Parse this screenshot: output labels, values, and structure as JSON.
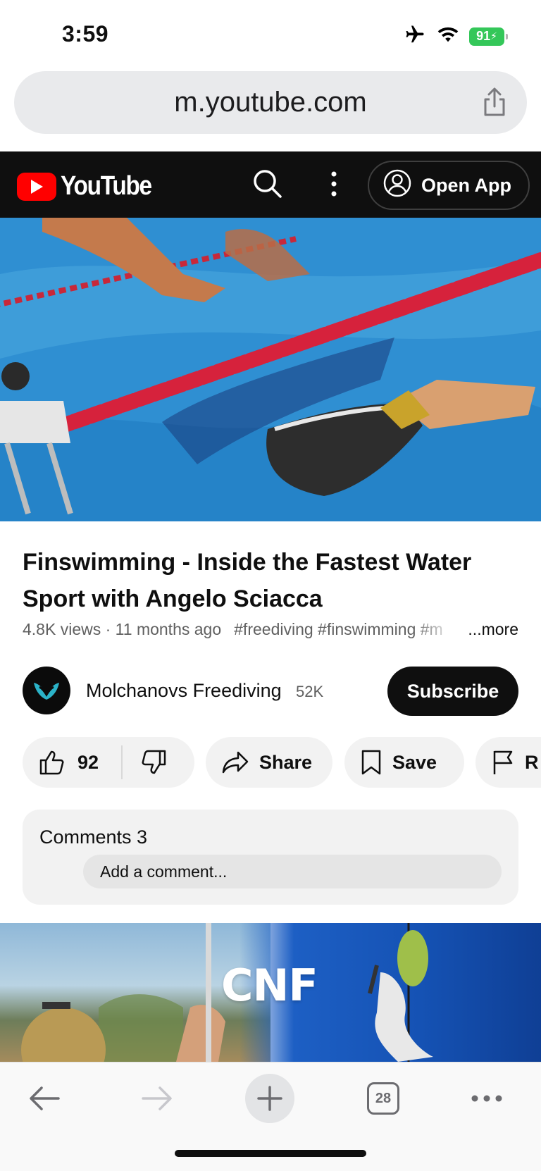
{
  "status_bar": {
    "time": "3:59",
    "battery_percent": "91",
    "icons": [
      "airplane-icon",
      "wifi-icon",
      "battery-icon"
    ]
  },
  "browser": {
    "url": "m.youtube.com",
    "tab_count": "28"
  },
  "youtube_header": {
    "logo_text": "YouTube",
    "open_app_label": "Open App"
  },
  "video": {
    "title": "Finswimming - Inside the Fastest Water Sport with Angelo Sciacca",
    "views": "4.8K views",
    "age": "11 months ago",
    "tags": "#freediving #finswimming #m",
    "more_label": "...more",
    "meta_separator": " · "
  },
  "channel": {
    "name": "Molchanovs Freediving",
    "subscribers": "52K",
    "subscribe_label": "Subscribe"
  },
  "actions": {
    "like_count": "92",
    "share_label": "Share",
    "save_label": "Save",
    "report_label": "R"
  },
  "comments": {
    "title": "Comments 3",
    "placeholder": "Add a comment..."
  },
  "next_video": {
    "thumbnail_text": "CNF"
  },
  "colors": {
    "youtube_red": "#ff0000",
    "header_bg": "#0f0f0f",
    "pill_bg": "#f2f2f2",
    "battery_green": "#34c759"
  }
}
